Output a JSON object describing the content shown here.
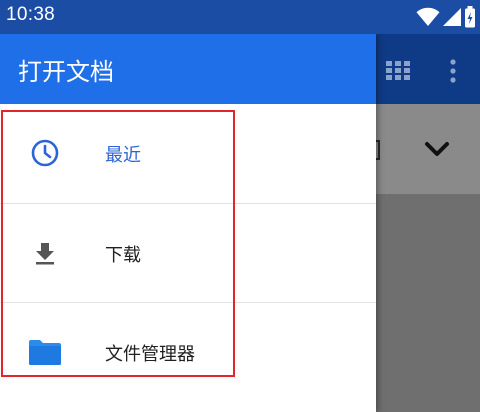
{
  "status_bar": {
    "time": "10:38",
    "icons": [
      "wifi-icon",
      "cellular-signal-icon",
      "battery-icon"
    ]
  },
  "drawer": {
    "title": "打开文档",
    "items": [
      {
        "label": "最近",
        "icon": "clock-icon",
        "active": true
      },
      {
        "label": "下载",
        "icon": "download-icon",
        "active": false
      },
      {
        "label": "文件管理器",
        "icon": "folder-icon",
        "active": false
      }
    ]
  },
  "background_toolbar": {
    "icons": [
      "grid-view-icon",
      "more-vert-icon",
      "chevron-down-icon"
    ]
  },
  "colors": {
    "accent": "#1e6fe8",
    "status_bar": "#1a4da3",
    "active_text": "#2c63d6",
    "highlight": "#e3262b"
  }
}
